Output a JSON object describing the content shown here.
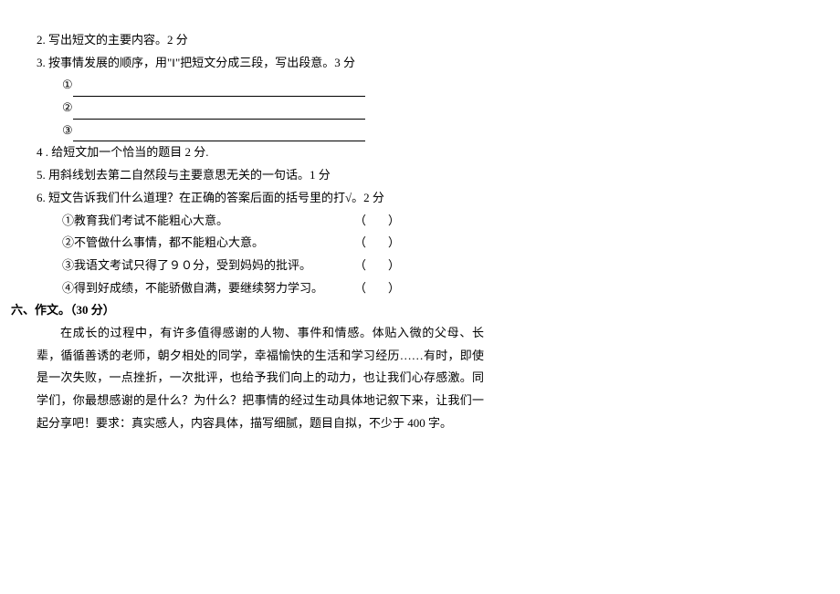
{
  "q2": "2. 写出短文的主要内容。2 分",
  "q3": "3. 按事情发展的顺序，用\"‖\"把短文分成三段，写出段意。3 分",
  "q3_marks": {
    "m1": "①",
    "m2": "②",
    "m3": "③"
  },
  "q4": "4 . 给短文加一个恰当的题目 2 分.",
  "q5": "5. 用斜线划去第二自然段与主要意思无关的一句话。1 分",
  "q6": "6. 短文告诉我们什么道理？在正确的答案后面的括号里的打√。2 分",
  "q6_options": {
    "o1": "①教育我们考试不能粗心大意。",
    "o2": "②不管做什么事情，都不能粗心大意。",
    "o3": "③我语文考试只得了９０分，受到妈妈的批评。",
    "o4": "④得到好成绩，不能骄傲自满，要继续努力学习。"
  },
  "bracket_pair": "（）",
  "section6": {
    "header": "六、作文。（30 分）",
    "body": "在成长的过程中，有许多值得感谢的人物、事件和情感。体贴入微的父母、长辈，循循善诱的老师，朝夕相处的同学，幸福愉快的生活和学习经历……有时，即使是一次失败，一点挫折，一次批评，也给予我们向上的动力，也让我们心存感激。同学们，你最想感谢的是什么？为什么？把事情的经过生动具体地记叙下来，让我们一起分享吧！要求：真实感人，内容具体，描写细腻，题目自拟，不少于 400 字。"
  }
}
